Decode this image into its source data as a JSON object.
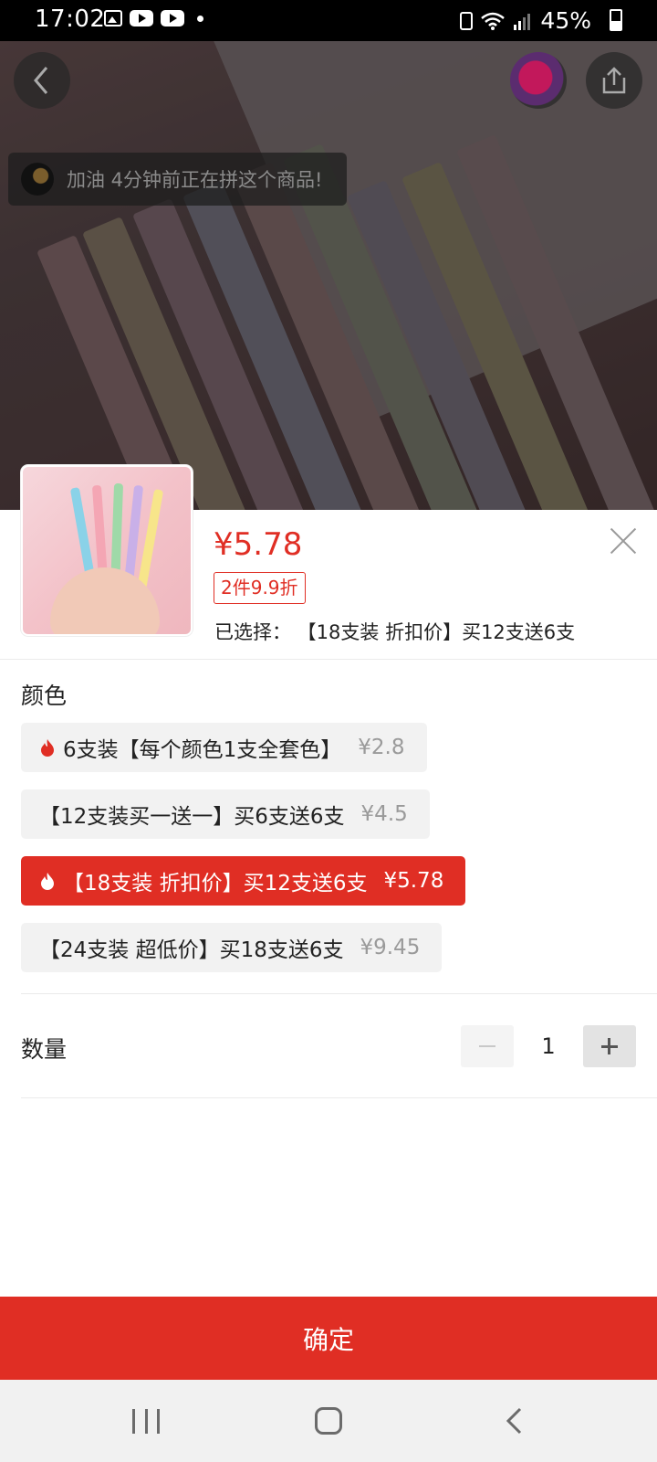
{
  "status_bar": {
    "time": "17:02",
    "battery_percent": "45%",
    "battery_level": 0.45,
    "icons": [
      "gallery-icon",
      "youtube-icon",
      "youtube-icon",
      "dot-icon",
      "battery-alert-icon",
      "wifi-icon",
      "signal-icon",
      "battery-icon"
    ]
  },
  "hero": {
    "toast_text": "加油 4分钟前正在拼这个商品!",
    "icons": [
      "back-arrow-icon",
      "share-icon"
    ]
  },
  "product": {
    "price": "¥5.78",
    "promo_tag": "2件9.9折",
    "selected_text": "已选择：  【18支装 折扣价】买12支送6支"
  },
  "color_section": {
    "title": "颜色",
    "options": [
      {
        "label": "6支装【每个颜色1支全套色】",
        "price": "¥2.8",
        "hot": true,
        "selected": false
      },
      {
        "label": "【12支装买一送一】买6支送6支",
        "price": "¥4.5",
        "hot": false,
        "selected": false
      },
      {
        "label": "【18支装 折扣价】买12支送6支",
        "price": "¥5.78",
        "hot": true,
        "selected": true
      },
      {
        "label": "【24支装 超低价】买18支送6支",
        "price": "¥9.45",
        "hot": false,
        "selected": false
      }
    ]
  },
  "quantity": {
    "label": "数量",
    "value": "1"
  },
  "confirm_label": "确定",
  "colors": {
    "accent": "#e02e24",
    "option_bg": "#f2f2f2",
    "muted_price": "#9a9a9a"
  },
  "navigation_bar": {
    "icons": [
      "recent-apps-icon",
      "home-icon",
      "back-icon"
    ]
  }
}
